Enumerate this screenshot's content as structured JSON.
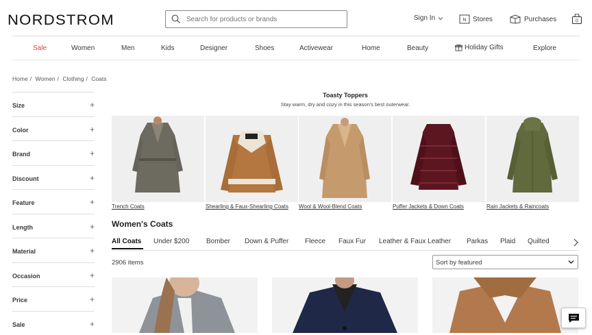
{
  "header": {
    "logo": "NORDSTROM",
    "search_placeholder": "Search for products or brands",
    "sign_in": "Sign In",
    "stores": "Stores",
    "purchases": "Purchases"
  },
  "nav": [
    "Sale",
    "Women",
    "Men",
    "Kids",
    "Designer",
    "Shoes",
    "Activewear",
    "Home",
    "Beauty",
    "Holiday Gifts",
    "Explore"
  ],
  "breadcrumbs": [
    "Home",
    "Women",
    "Clothing",
    "Coats"
  ],
  "facets": [
    "Size",
    "Color",
    "Brand",
    "Discount",
    "Feature",
    "Length",
    "Material",
    "Occasion",
    "Price",
    "Sale"
  ],
  "promo": {
    "title": "Toasty Toppers",
    "subtitle": "Stay warm, dry and cozy in this season's best outerwear.",
    "tiles": [
      {
        "label": "Trench Coats"
      },
      {
        "label": "Shearling & Faux-Shearling Coats"
      },
      {
        "label": "Wool & Wool-Blend Coats"
      },
      {
        "label": "Puffer Jackets & Down Coats"
      },
      {
        "label": "Rain Jackets & Raincoats"
      }
    ]
  },
  "listing": {
    "title": "Women's Coats",
    "categories": [
      "All Coats",
      "Under $200",
      "Bomber",
      "Down & Puffer",
      "Fleece",
      "Faux Fur",
      "Leather & Faux Leather",
      "Parkas",
      "Plaid",
      "Quilted"
    ],
    "count": "2906 items",
    "sort": "Sort by featured"
  },
  "colors": {
    "sale": "#d8452f",
    "text": "#393939",
    "border": "#dddddd"
  }
}
